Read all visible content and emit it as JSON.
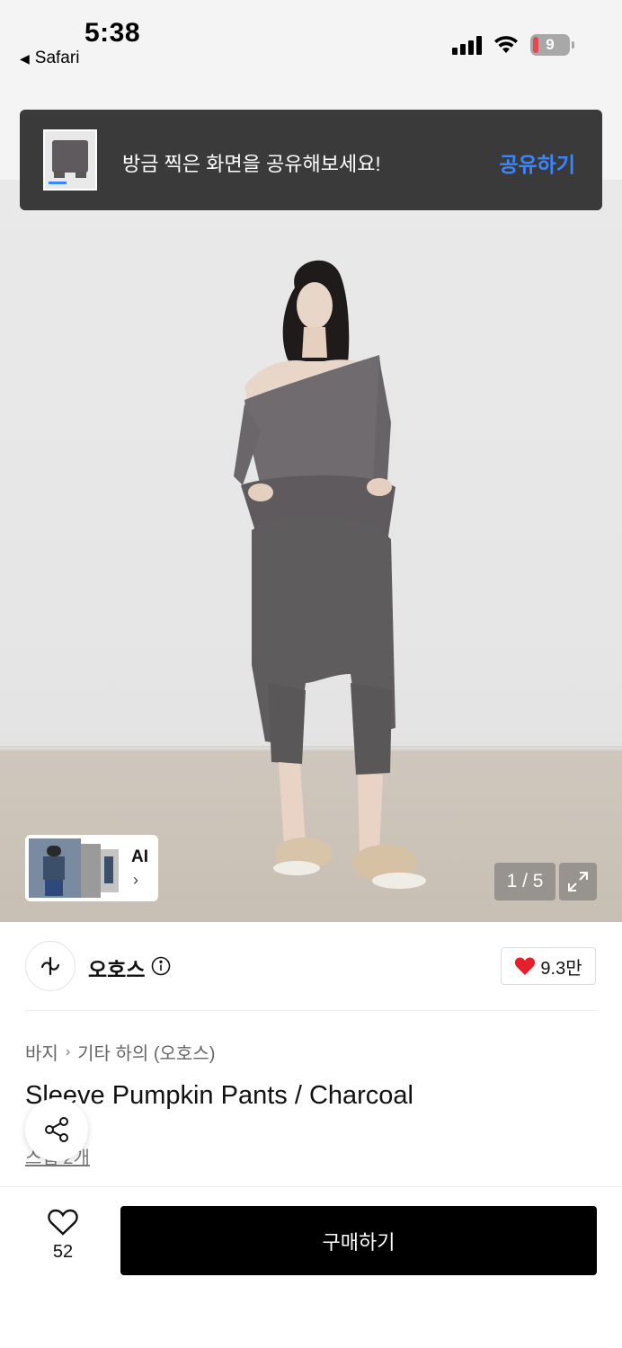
{
  "status_bar": {
    "time": "5:38",
    "back_app": "Safari",
    "battery": "9"
  },
  "toast": {
    "message": "방금 찍은 화면을 공유해보세요!",
    "action": "공유하기"
  },
  "gallery": {
    "ai_label": "AI",
    "ai_chevron": "›",
    "pager": "1 / 5"
  },
  "brand": {
    "name": "오호스",
    "likes": "9.3만"
  },
  "breadcrumb": {
    "items": [
      "바지",
      "기타 하의 (오호스)"
    ],
    "separator": "›"
  },
  "product": {
    "title": "Sleeve Pumpkin Pants / Charcoal",
    "snap_link": "스냅 2개"
  },
  "bottom_bar": {
    "wish_count": "52",
    "buy_label": "구매하기"
  },
  "colors": {
    "toast_bg": "#3a3a3a",
    "toast_action": "#3a86ff",
    "heart": "#e5202a",
    "buy_bg": "#000000"
  }
}
